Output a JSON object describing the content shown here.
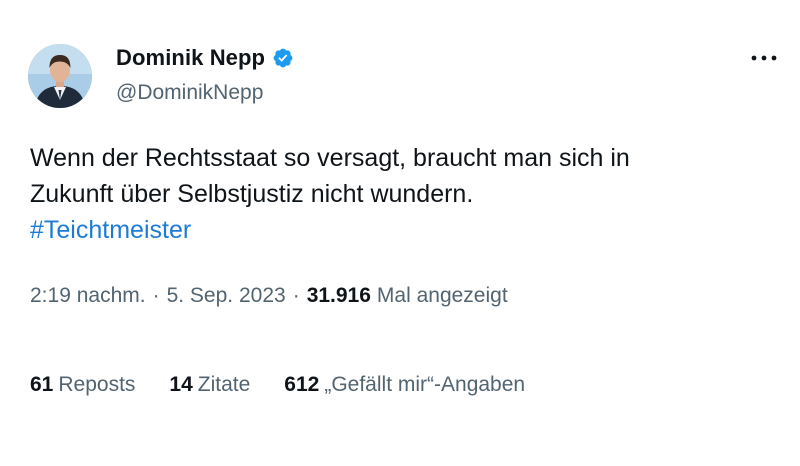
{
  "author": {
    "display_name": "Dominik Nepp",
    "handle": "@DominikNepp",
    "verified_color": "#1d9bf0"
  },
  "tweet": {
    "text_line_1": "Wenn der Rechtsstaat so versagt, braucht man sich in",
    "text_line_2": "Zukunft über Selbstjustiz nicht wundern.",
    "hashtag": "#Teichtmeister",
    "hashtag_color": "#1d7bd8"
  },
  "meta": {
    "time": "2:19 nachm.",
    "separator": "·",
    "date": "5. Sep. 2023",
    "views_count": "31.916",
    "views_label": "Mal angezeigt"
  },
  "stats": {
    "reposts_count": "61",
    "reposts_label": "Reposts",
    "quotes_count": "14",
    "quotes_label": "Zitate",
    "likes_count": "612",
    "likes_label": "„Gefällt mir“-Angaben"
  },
  "icons": {
    "avatar": "profile-photo",
    "verified": "verified-badge-icon",
    "more": "more-horizontal-icon"
  }
}
